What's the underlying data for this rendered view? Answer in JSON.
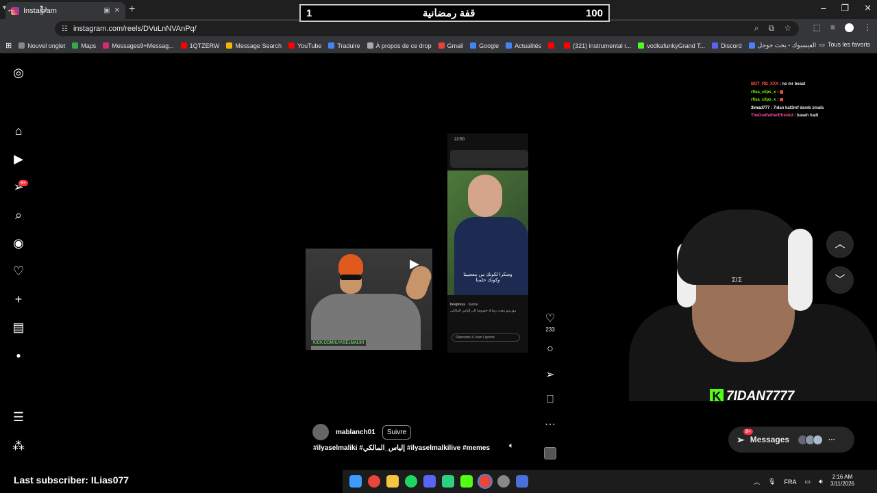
{
  "browser": {
    "tab_title": "Instagram",
    "url": "instagram.com/reels/DVuLnNVAnPq/",
    "bookmarks": [
      {
        "label": "Nouvel onglet",
        "color": "#888888"
      },
      {
        "label": "Maps",
        "color": "#34a853"
      },
      {
        "label": "Messages9+Messag...",
        "color": "#d62976"
      },
      {
        "label": "1QTZERW",
        "color": "#ff0000"
      },
      {
        "label": "Message Search",
        "color": "#f4b400"
      },
      {
        "label": "YouTube",
        "color": "#ff0000"
      },
      {
        "label": "Traduire",
        "color": "#4285f4"
      },
      {
        "label": "À propos de ce drop",
        "color": "#aaaaaa"
      },
      {
        "label": "Gmail",
        "color": "#ea4335"
      },
      {
        "label": "Google",
        "color": "#4285f4"
      },
      {
        "label": "Actualités",
        "color": "#4285f4"
      },
      {
        "label": "",
        "color": "#ff0000"
      },
      {
        "label": "(321) instrumental r...",
        "color": "#ff0000"
      },
      {
        "label": "vodkafunkyGrand T...",
        "color": "#53fc18"
      },
      {
        "label": "Discord",
        "color": "#5865f2"
      },
      {
        "label": "الفيسبوك - بحث جوجل",
        "color": "#4285f4"
      }
    ],
    "all_bookmarks": "Tous les favoris"
  },
  "overlay": {
    "left_num": "1",
    "title": "قفة رمضانية",
    "right_num": "100"
  },
  "sidebar": {
    "notification_badge": "9+"
  },
  "reel": {
    "phone_time": "22:50",
    "phone_subtitle_1": "وشكرا لكونك من معجبينا",
    "phone_subtitle_2": "وكونك حلمنا",
    "phone_account": "hespress",
    "phone_follow": "Suivre",
    "phone_caption": "مورينيو يبعث رسالة خصوصا إلى إلياس المالكي",
    "phone_reply": "Répondre à Joan Laporta",
    "man_caption": "KICK.COM/ILYASELMALIKI",
    "username": "mablanch01",
    "follow_label": "Suivre",
    "hashtags": "#ilyaselmaliki #إلياس_المالكي #ilyaselmalkilive #memes",
    "likes": "233"
  },
  "chat": [
    {
      "user": "BOT_RB_XXX",
      "msg": "no mr beast",
      "color": "#ff4d4d"
    },
    {
      "user": "rfisa_clips_x",
      "msg": "",
      "color": "#7cfc00"
    },
    {
      "user": "rfisa_clips_x",
      "msg": "",
      "color": "#7cfc00"
    },
    {
      "user": "3imad777",
      "msg": "7idan kat3ref dareb zmala",
      "color": "#ffffff"
    },
    {
      "user": "TheGodfatherEfrenkd",
      "msg": "baseh hadi",
      "color": "#ff4fa3"
    }
  ],
  "webcam": {
    "streamer_name": "7IDAN7777",
    "beanie_logo": "ΣIΣ"
  },
  "messages": {
    "label": "Messages",
    "badge": "9+"
  },
  "bottom": {
    "last_subscriber": "Last subscriber: ILias077"
  },
  "taskbar": {
    "lang": "FRA",
    "time": "2:16 AM",
    "date": "3/11/2026"
  }
}
